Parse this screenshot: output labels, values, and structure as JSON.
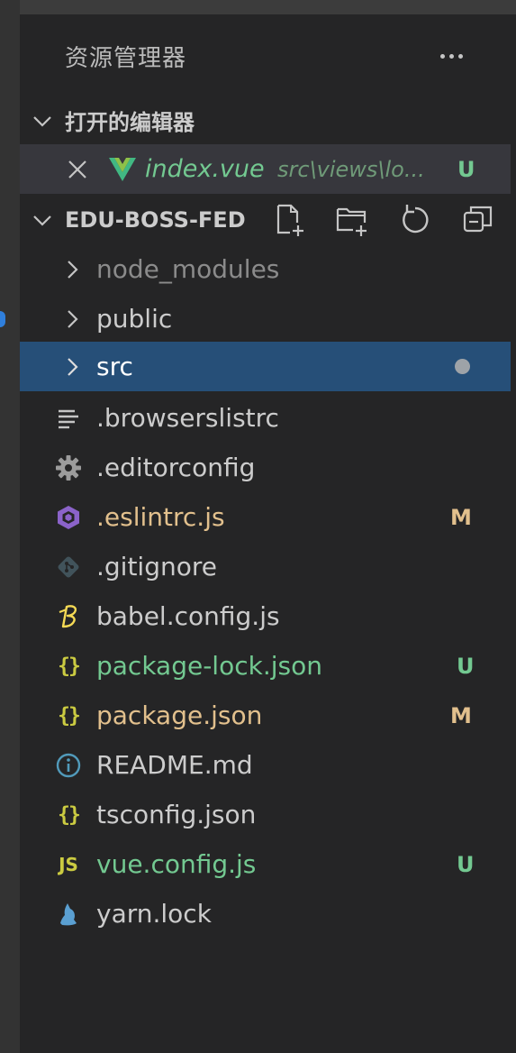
{
  "explorer": {
    "title": "资源管理器"
  },
  "open_editors": {
    "title": "打开的编辑器",
    "items": [
      {
        "name": "index.vue",
        "path": "src\\views\\lo...",
        "status": "U"
      }
    ]
  },
  "project": {
    "title": "EDU-BOSS-FED",
    "actions": [
      "new-file",
      "new-folder",
      "refresh",
      "collapse-all"
    ]
  },
  "tree": [
    {
      "name": "node_modules",
      "type": "folder",
      "color": "#8b8b8b"
    },
    {
      "name": "public",
      "type": "folder",
      "color": "#cccccc"
    },
    {
      "name": "src",
      "type": "folder",
      "color": "#ffffff",
      "selected": true,
      "modified_dot": true
    },
    {
      "name": ".browserslistrc",
      "type": "file",
      "icon": "lines-icon",
      "color": "#cccccc"
    },
    {
      "name": ".editorconfig",
      "type": "file",
      "icon": "gear-icon",
      "color": "#cccccc"
    },
    {
      "name": ".eslintrc.js",
      "type": "file",
      "icon": "eslint-icon",
      "color": "#e2c08d",
      "status": "M"
    },
    {
      "name": ".gitignore",
      "type": "file",
      "icon": "git-icon",
      "color": "#cccccc"
    },
    {
      "name": "babel.config.js",
      "type": "file",
      "icon": "babel-icon",
      "color": "#cccccc"
    },
    {
      "name": "package-lock.json",
      "type": "file",
      "icon": "json-icon",
      "color": "#73c991",
      "status": "U"
    },
    {
      "name": "package.json",
      "type": "file",
      "icon": "json-icon",
      "color": "#e2c08d",
      "status": "M"
    },
    {
      "name": "README.md",
      "type": "file",
      "icon": "info-icon",
      "color": "#cccccc"
    },
    {
      "name": "tsconfig.json",
      "type": "file",
      "icon": "json-icon",
      "color": "#cccccc"
    },
    {
      "name": "vue.config.js",
      "type": "file",
      "icon": "js-icon",
      "color": "#73c991",
      "status": "U"
    },
    {
      "name": "yarn.lock",
      "type": "file",
      "icon": "yarn-icon",
      "color": "#cccccc"
    }
  ],
  "icon_labels": {
    "json": "{}",
    "js": "JS"
  },
  "colors": {
    "background": "#252526",
    "selection": "#264f78",
    "untracked": "#73c991",
    "modified": "#e2c08d"
  }
}
